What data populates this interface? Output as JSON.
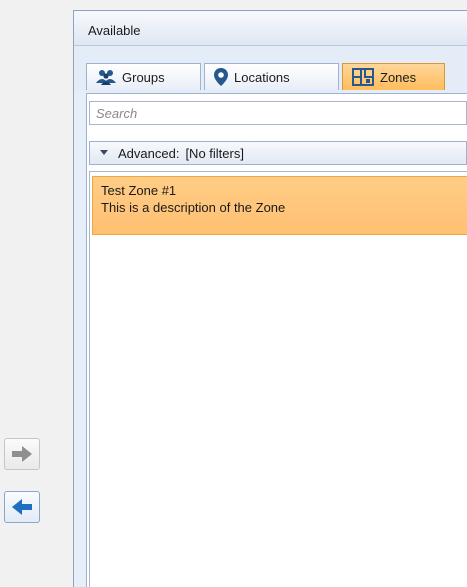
{
  "panel": {
    "title": "Available"
  },
  "tabs": [
    {
      "label": "Groups",
      "icon": "groups-icon",
      "active": false
    },
    {
      "label": "Locations",
      "icon": "location-pin-icon",
      "active": false
    },
    {
      "label": "Zones",
      "icon": "zones-icon",
      "active": true
    }
  ],
  "search": {
    "placeholder": "Search",
    "value": ""
  },
  "advanced": {
    "label": "Advanced:",
    "value": "[No filters]"
  },
  "list": {
    "items": [
      {
        "title": "Test Zone #1",
        "description": "This is a description of the Zone",
        "selected": true
      }
    ]
  },
  "side_buttons": {
    "add": "arrow-right-icon",
    "remove": "arrow-left-icon"
  },
  "colors": {
    "accent": "#ffc072",
    "panel": "#e6eefa",
    "arrow_enabled": "#1f6fc1",
    "arrow_disabled": "#8f8f8f"
  }
}
